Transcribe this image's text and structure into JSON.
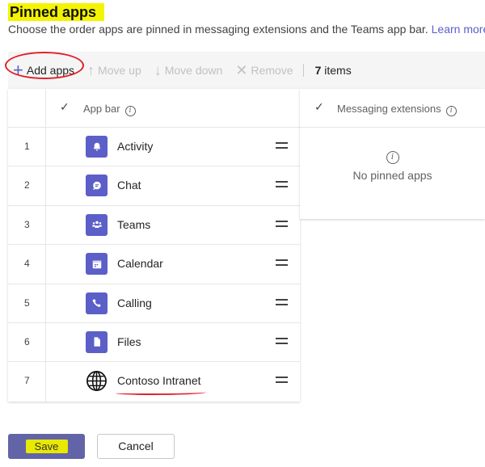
{
  "header": {
    "title": "Pinned apps",
    "subtitle": "Choose the order apps are pinned in messaging extensions and the Teams app bar.",
    "learn_more": "Learn more"
  },
  "toolbar": {
    "add": "Add apps",
    "move_up": "Move up",
    "move_down": "Move down",
    "remove": "Remove",
    "count_num": "7",
    "count_label": "items"
  },
  "app_bar": {
    "header": "App bar",
    "rows": [
      {
        "num": "1",
        "name": "Activity",
        "icon": "bell-icon"
      },
      {
        "num": "2",
        "name": "Chat",
        "icon": "chat-icon"
      },
      {
        "num": "3",
        "name": "Teams",
        "icon": "teams-icon"
      },
      {
        "num": "4",
        "name": "Calendar",
        "icon": "calendar-icon"
      },
      {
        "num": "5",
        "name": "Calling",
        "icon": "phone-icon"
      },
      {
        "num": "6",
        "name": "Files",
        "icon": "file-icon"
      },
      {
        "num": "7",
        "name": "Contoso Intranet",
        "icon": "globe-icon"
      }
    ]
  },
  "messaging": {
    "header": "Messaging extensions",
    "empty": "No pinned apps"
  },
  "footer": {
    "save": "Save",
    "cancel": "Cancel"
  },
  "colors": {
    "accent": "#5b5fc7",
    "highlight": "#f4f400",
    "annotation": "#e0202a"
  }
}
